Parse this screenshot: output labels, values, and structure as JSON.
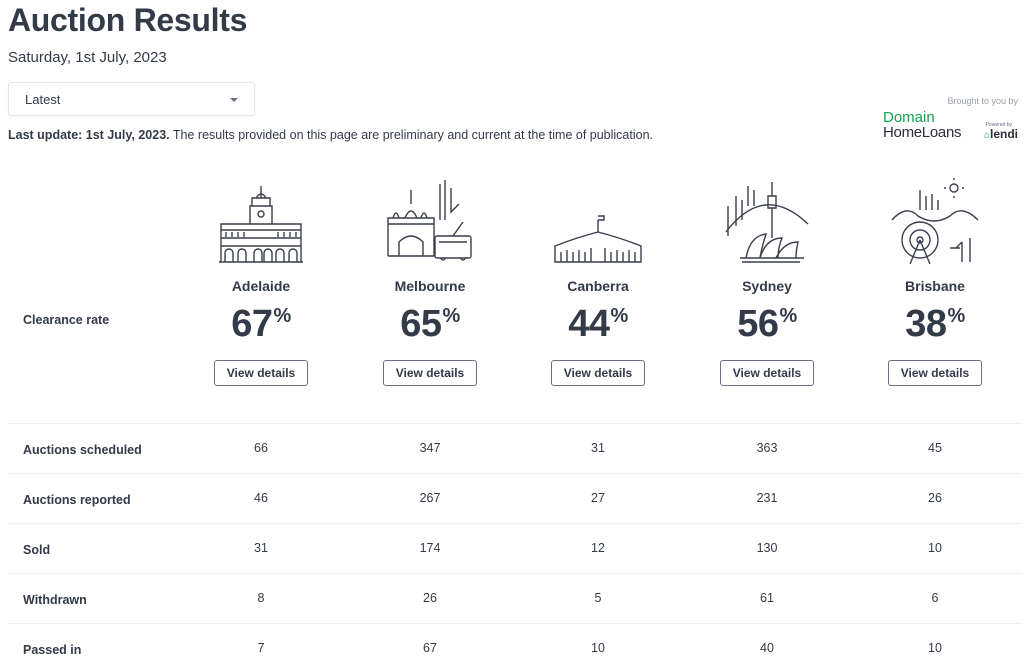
{
  "header": {
    "title": "Auction Results",
    "date": "Saturday, 1st July, 2023"
  },
  "period_select": {
    "value": "Latest"
  },
  "notice": {
    "bold": "Last update: 1st July, 2023.",
    "text": " The results provided on this page are preliminary and current at the time of publication."
  },
  "sponsor": {
    "brought_by": "Brought to you by",
    "brand_line1": "Domain",
    "brand_line2": "HomeLoans",
    "powered_by": "Powered by",
    "partner": "lendi",
    "brand_color": "#0ea44b"
  },
  "clearance": {
    "label": "Clearance rate",
    "pct_symbol": "%",
    "button_label": "View details"
  },
  "cities": [
    {
      "name": "Adelaide",
      "rate": "67",
      "icon": "adelaide-town-hall-icon"
    },
    {
      "name": "Melbourne",
      "rate": "65",
      "icon": "melbourne-flinders-tram-icon"
    },
    {
      "name": "Canberra",
      "rate": "44",
      "icon": "canberra-parliament-icon"
    },
    {
      "name": "Sydney",
      "rate": "56",
      "icon": "sydney-opera-bridge-icon"
    },
    {
      "name": "Brisbane",
      "rate": "38",
      "icon": "brisbane-bridge-wheel-icon"
    }
  ],
  "table": {
    "rows": [
      {
        "label": "Auctions scheduled",
        "values": [
          "66",
          "347",
          "31",
          "363",
          "45"
        ]
      },
      {
        "label": "Auctions reported",
        "values": [
          "46",
          "267",
          "27",
          "231",
          "26"
        ]
      },
      {
        "label": "Sold",
        "values": [
          "31",
          "174",
          "12",
          "130",
          "10"
        ]
      },
      {
        "label": "Withdrawn",
        "values": [
          "8",
          "26",
          "5",
          "61",
          "6"
        ]
      },
      {
        "label": "Passed in",
        "values": [
          "7",
          "67",
          "10",
          "40",
          "10"
        ]
      }
    ]
  }
}
